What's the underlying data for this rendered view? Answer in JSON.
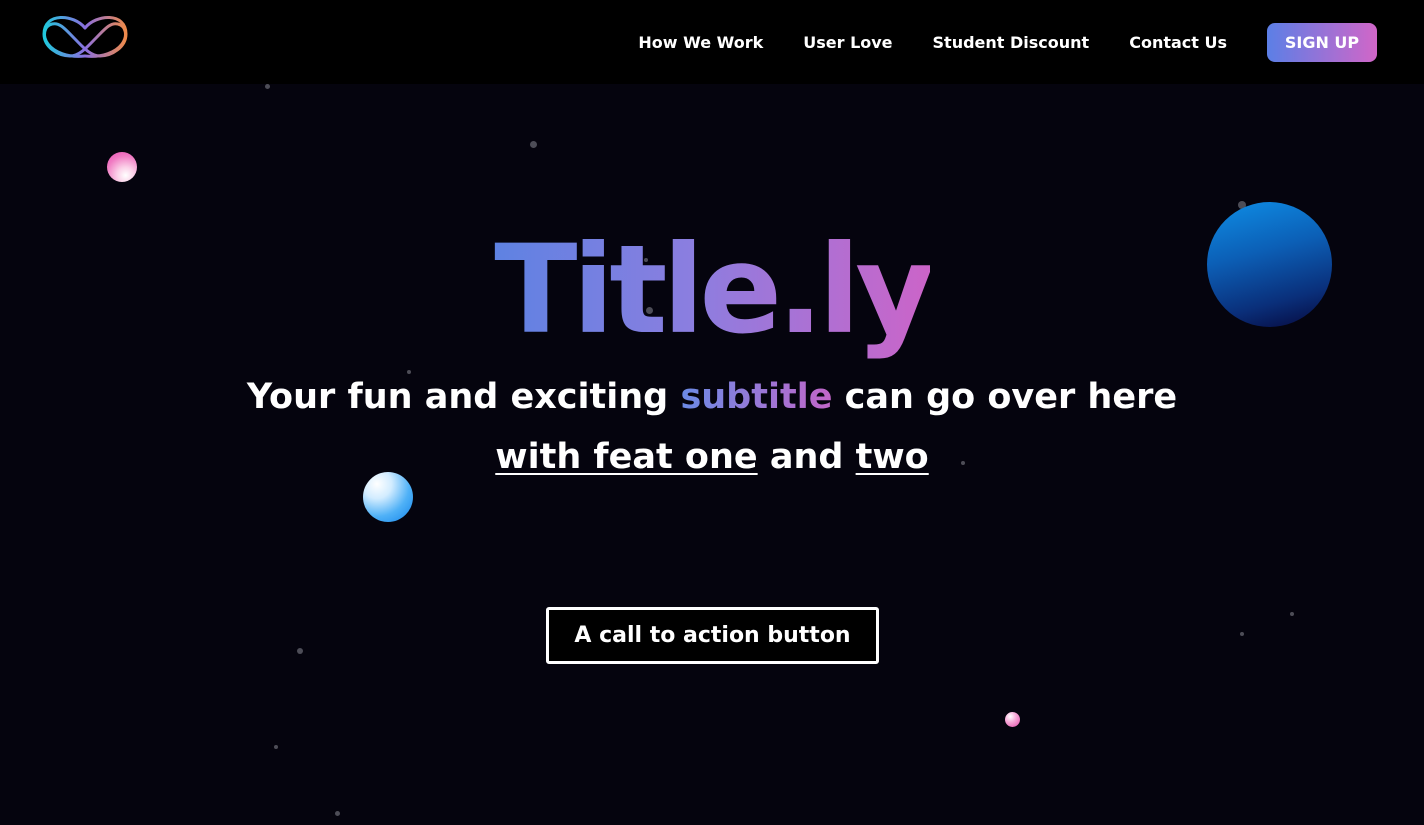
{
  "header": {
    "nav": [
      {
        "label": "How We Work"
      },
      {
        "label": "User Love"
      },
      {
        "label": "Student Discount"
      },
      {
        "label": "Contact Us"
      }
    ],
    "signup_label": "SIGN UP"
  },
  "hero": {
    "title": "Title.ly",
    "subtitle": {
      "before": "Your fun and exciting ",
      "accent": "subtitle",
      "after": " can go over here"
    },
    "features": {
      "one": "with feat one",
      "joiner": " and ",
      "two": "two"
    },
    "cta_label": "A call to action button"
  },
  "colors": {
    "background": "#05040e",
    "header_background": "#000000",
    "gradient_start": "#5b7fe6",
    "gradient_end": "#d166c8"
  },
  "icons": {
    "logo": "heart-infinity-logo-icon"
  }
}
